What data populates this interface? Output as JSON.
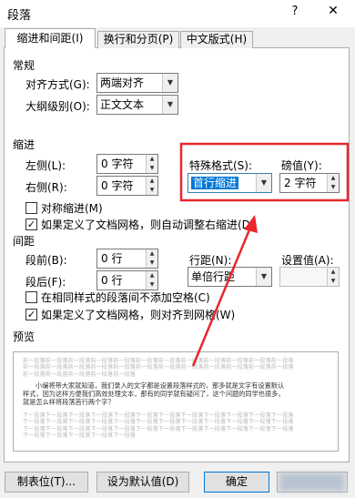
{
  "window": {
    "title": "段落",
    "help": "?",
    "close": "✕"
  },
  "tabs": [
    {
      "label": "缩进和间距(I)"
    },
    {
      "label": "换行和分页(P)"
    },
    {
      "label": "中文版式(H)"
    }
  ],
  "general": {
    "heading": "常规",
    "alignment_label": "对齐方式(G):",
    "alignment_value": "两端对齐",
    "outline_label": "大纲级别(O):",
    "outline_value": "正文文本"
  },
  "indent": {
    "heading": "缩进",
    "left_label": "左侧(L):",
    "left_value": "0 字符",
    "right_label": "右侧(R):",
    "right_value": "0 字符",
    "special_label": "特殊格式(S):",
    "special_value": "首行缩进",
    "by_label": "磅值(Y):",
    "by_value": "2 字符",
    "mirror_label": "对称缩进(M)",
    "mirror_checked": false,
    "auto_adjust_label": "如果定义了文档网格，则自动调整右缩进(D)",
    "auto_adjust_checked": true
  },
  "spacing": {
    "heading": "间距",
    "before_label": "段前(B):",
    "before_value": "0 行",
    "after_label": "段后(F):",
    "after_value": "0 行",
    "line_label": "行距(N):",
    "line_value": "单倍行距",
    "at_label": "设置值(A):",
    "at_value": "",
    "no_space_label": "在相同样式的段落间不添加空格(C)",
    "no_space_checked": false,
    "snap_grid_label": "如果定义了文档网格，则对齐到网格(W)",
    "snap_grid_checked": true
  },
  "preview": {
    "heading": "预览",
    "prev_lines": [
      "前一段落前一段落前一段落前一段落前一段落前一段落前一段落前一段落前一段落前一段落前一段落前一段落",
      "前一段落前一段落前一段落前一段落前一段落前一段落前一段落前一段落前一段落前一段落前一段落前一段落",
      "前一段落前一段落前一段落前一段落前一段落"
    ],
    "sample_lines": [
      "小编将带大家就知道，我们录入的文字都是设置段落样式的，那多就是文字有设置默认",
      "样式，因为这样方便我们高效处理文本，那有的同学就有疑问了，这个问题的同学也很多，",
      "就是怎么样将段落首行两个字？"
    ],
    "next_lines": [
      "下一段落下一段落下一段落下一段落下一段落下一段落下一段落下一段落下一段落下一段落下一段落下一段落",
      "下一段落下一段落下一段落下一段落下一段落下一段落下一段落下一段落下一段落下一段落下一段落下一段落",
      "下一段落下一段落下一段落下一段落下一段落下一段落下一段落下一段落下一段落下一段落下一段落下一段落",
      "下一段落下一段落下一段落下一段落下一段落"
    ]
  },
  "buttons": {
    "tabs_label": "制表位(T)...",
    "default_label": "设为默认值(D)",
    "ok_label": "确定",
    "cancel_label": "取消"
  },
  "annotation_color": "#e8262b"
}
